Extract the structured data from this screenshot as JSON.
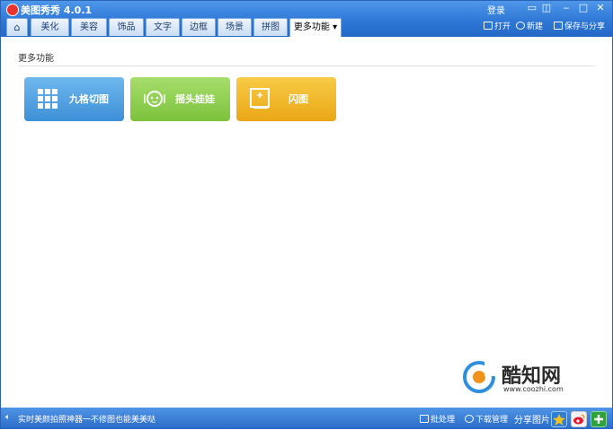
{
  "app": {
    "title": "美图秀秀 4.0.1"
  },
  "window": {
    "login_label": "登录"
  },
  "tabs": [
    {
      "id": "home",
      "label": ""
    },
    {
      "id": "beautify",
      "label": "美化"
    },
    {
      "id": "beauty",
      "label": "美容"
    },
    {
      "id": "accessories",
      "label": "饰品"
    },
    {
      "id": "text",
      "label": "文字"
    },
    {
      "id": "border",
      "label": "边框"
    },
    {
      "id": "scene",
      "label": "场景"
    },
    {
      "id": "collage",
      "label": "拼图"
    },
    {
      "id": "more",
      "label": "更多功能 ▾",
      "active": true
    }
  ],
  "toolbar": {
    "open_label": "打开",
    "new_label": "新建",
    "save_label": "保存与分享"
  },
  "main": {
    "section_title": "更多功能",
    "features": [
      {
        "id": "nine-grid",
        "label": "九格切图",
        "color": "#4a9fe0",
        "icon": "grid-icon"
      },
      {
        "id": "bobblehead",
        "label": "摇头娃娃",
        "color": "#8fd04f",
        "icon": "doll-icon"
      },
      {
        "id": "flash",
        "label": "闪图",
        "color": "#f2b82a",
        "icon": "flash-frame-icon"
      }
    ]
  },
  "statusbar": {
    "message": "实时美颜拍照神器一不修图也能美美哒",
    "batch_label": "批处理",
    "download_label": "下载管理",
    "share_label": "分享图片"
  },
  "watermark": {
    "brand": "酷知网",
    "url": "www.coozhi.com"
  }
}
